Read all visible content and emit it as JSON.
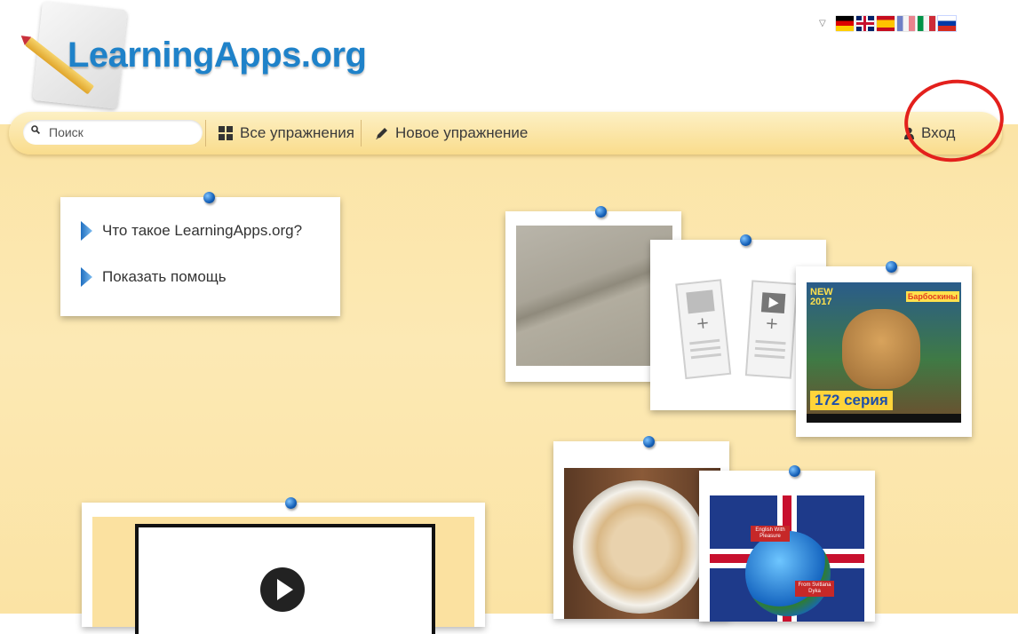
{
  "header": {
    "logo_text": "LearningApps.org",
    "languages": [
      {
        "code": "de",
        "icon": "germany-flag-icon"
      },
      {
        "code": "en",
        "icon": "uk-flag-icon"
      },
      {
        "code": "es",
        "icon": "spain-flag-icon"
      },
      {
        "code": "fr",
        "icon": "france-flag-icon"
      },
      {
        "code": "it",
        "icon": "italy-flag-icon"
      },
      {
        "code": "ru",
        "icon": "russia-flag-icon"
      }
    ],
    "language_toggle_glyph": "▽"
  },
  "nav": {
    "search_placeholder": "Поиск",
    "all_exercises_label": "Все упражнения",
    "new_exercise_label": "Новое упражнение",
    "login_label": "Вход"
  },
  "info_card": {
    "items": [
      {
        "label": "Что такое LearningApps.org?"
      },
      {
        "label": "Показать помощь"
      }
    ]
  },
  "thumbnails": {
    "cartoon_badge": "NEW 2017",
    "cartoon_brand": "Барбоскины",
    "cartoon_episode": "172 серия",
    "english_title": "English With Pleasure",
    "english_author": "From Svitlana Dyka"
  },
  "colors": {
    "accent": "#1f82c9",
    "board": "#fce9b4",
    "nav": "#f9dc8c",
    "highlight_circle": "#e3201c"
  }
}
